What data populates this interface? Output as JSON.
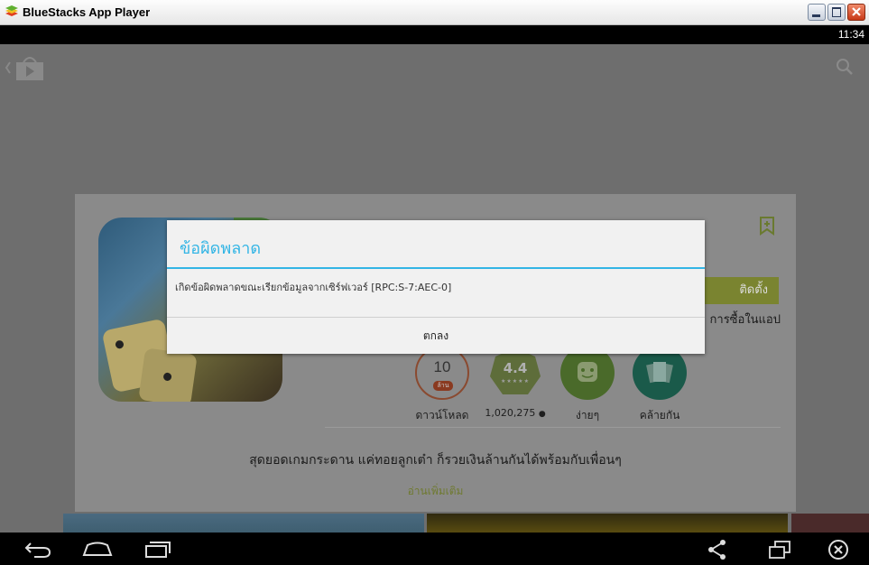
{
  "window": {
    "title": "BlueStacks App Player"
  },
  "statusbar": {
    "clock": "11:34"
  },
  "app": {
    "install_label": "ติดตั้ง",
    "in_app_purchases": "การซื้อในแอป",
    "stats": [
      {
        "value": "10",
        "unit": "ล้าน",
        "label": "ดาวน์โหลด"
      },
      {
        "value": "4.4",
        "stars": "★★★★★",
        "label": "1,020,275"
      },
      {
        "label": "ง่ายๆ"
      },
      {
        "label": "คล้ายกัน"
      }
    ],
    "description": "สุดยอดเกมกระดาน แค่ทอยลูกเต๋า ก็รวยเงินล้านกันได้พร้อมกับเพื่อนๆ",
    "read_more": "อ่านเพิ่มเติม"
  },
  "dialog": {
    "title": "ข้อผิดพลาด",
    "message": "เกิดข้อผิดพลาดขณะเรียกข้อมูลจากเซิร์ฟเวอร์ [RPC:S-7:AEC-0]",
    "ok_label": "ตกลง"
  },
  "colors": {
    "accent": "#33b5e5",
    "install": "#99cc00"
  }
}
